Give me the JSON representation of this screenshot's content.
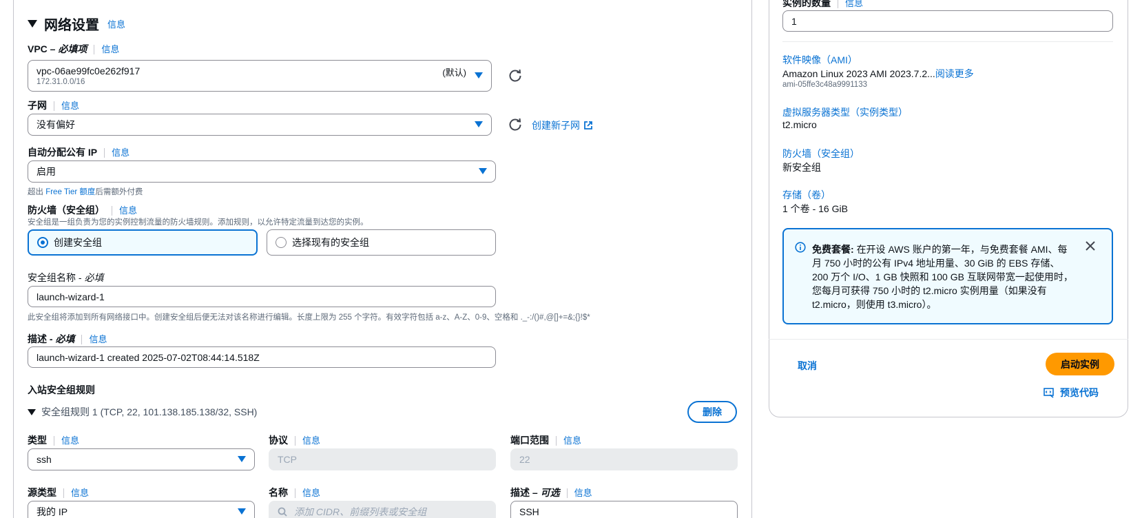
{
  "network": {
    "title": "网络设置",
    "info": "信息",
    "vpc": {
      "label_main": "VPC – ",
      "label_req": "必填项",
      "info": "信息",
      "value": "vpc-06ae99fc0e262f917",
      "sub": "172.31.0.0/16",
      "badge": "(默认)"
    },
    "subnet": {
      "label": "子网",
      "info": "信息",
      "value": "没有偏好",
      "create_link": "创建新子网"
    },
    "public_ip": {
      "label": "自动分配公有 IP",
      "info": "信息",
      "value": "启用",
      "hint_prefix": "超出 ",
      "hint_link": "Free Tier 额度",
      "hint_suffix": "后需额外付费"
    },
    "firewall": {
      "label": "防火墙（安全组）",
      "info": "信息",
      "desc": "安全组是一组负责为您的实例控制流量的防火墙规则。添加规则，以允许特定流量到达您的实例。",
      "option_create": "创建安全组",
      "option_existing": "选择现有的安全组"
    },
    "sg_name": {
      "label_main": "安全组名称 - ",
      "label_req": "必填",
      "value": "launch-wizard-1",
      "hint": "此安全组将添加到所有网络接口中。创建安全组后便无法对该名称进行编辑。长度上限为 255 个字符。有效字符包括 a-z、A-Z、0-9、空格和 ._-:/()#,@[]+=&;{}!$*"
    },
    "description": {
      "label_main": "描述 - ",
      "label_req": "必填",
      "info": "信息",
      "value": "launch-wizard-1 created 2025-07-02T08:44:14.518Z"
    },
    "inbound": {
      "title": "入站安全组规则",
      "rule_title": "安全组规则 1 (TCP, 22, 101.138.185.138/32, SSH)",
      "delete": "删除",
      "type_label": "类型",
      "type_info": "信息",
      "type_value": "ssh",
      "protocol_label": "协议",
      "protocol_info": "信息",
      "protocol_value": "TCP",
      "port_label": "端口范围",
      "port_info": "信息",
      "port_value": "22",
      "source_label": "源类型",
      "source_info": "信息",
      "source_value": "我的 IP",
      "name_label": "名称",
      "name_info": "信息",
      "name_placeholder": "添加 CIDR、前缀列表或安全组",
      "desc_label_main": "描述 – ",
      "desc_label_opt": "可选",
      "desc_info": "信息",
      "desc_value": "SSH"
    }
  },
  "summary": {
    "count_label": "实例的数量",
    "count_info": "信息",
    "count_value": "1",
    "ami_label": "软件映像（AMI）",
    "ami_value": "Amazon Linux 2023 AMI 2023.7.2...",
    "ami_more": "阅读更多",
    "ami_id": "ami-05ffe3c48a9991133",
    "type_label": "虚拟服务器类型（实例类型）",
    "type_value": "t2.micro",
    "fw_label": "防火墙（安全组）",
    "fw_value": "新安全组",
    "storage_label": "存储（卷）",
    "storage_value": "1 个卷 - 16 GiB",
    "free_tier_title": "免费套餐:",
    "free_tier_text": "在开设 AWS 账户的第一年，与免费套餐 AMI、每月 750 小时的公有 IPv4 地址用量、30 GiB 的 EBS 存储、200 万个 I/O、1 GB 快照和 100 GB 互联网带宽一起使用时，您每月可获得 750 小时的 t2.micro 实例用量（如果没有 t2.micro，则使用 t3.micro）。",
    "cancel": "取消",
    "launch": "启动实例",
    "preview": "预览代码"
  },
  "colors": {
    "accent": "#0972d3",
    "primary_button": "#ff9900"
  }
}
